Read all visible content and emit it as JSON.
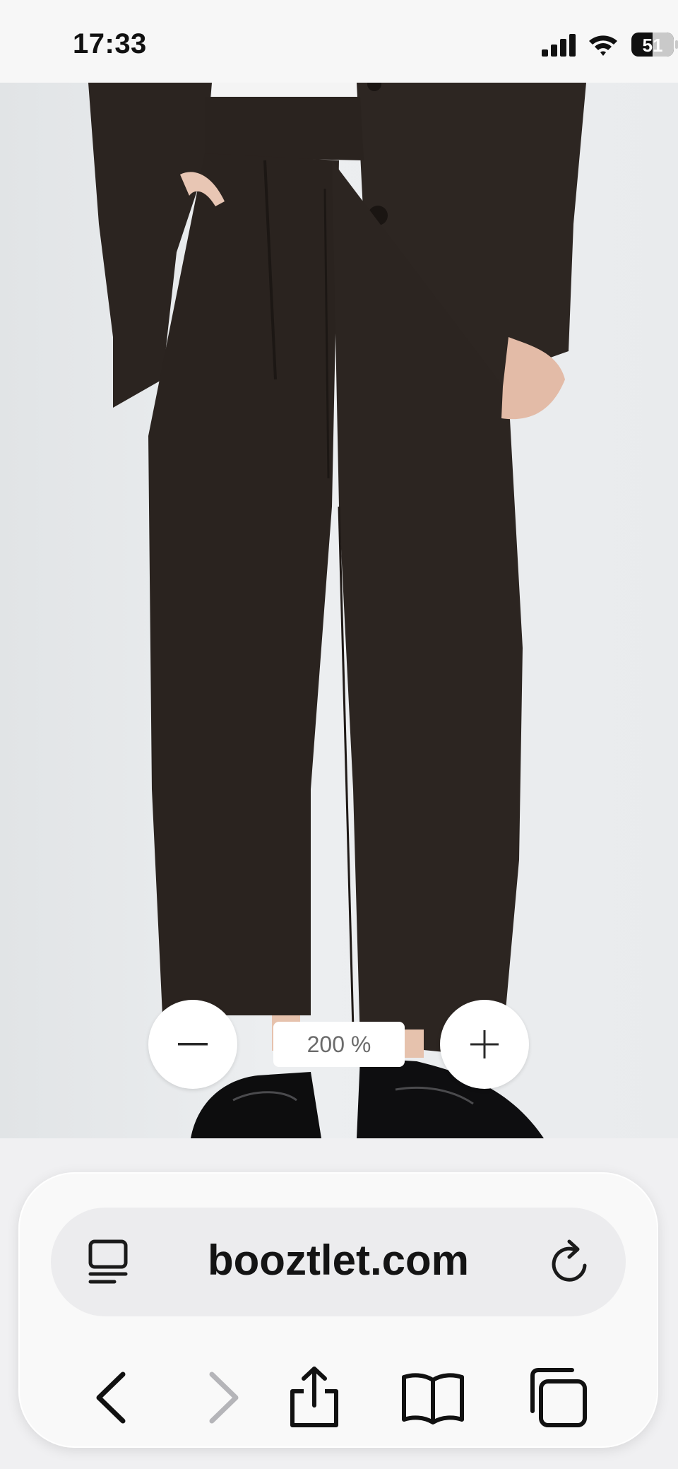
{
  "status_bar": {
    "time": "17:33",
    "battery_level": "51",
    "icons": [
      "signal-icon",
      "wifi-icon",
      "battery-icon"
    ]
  },
  "product_image": {
    "subject": "pleated-wide-trousers-photo"
  },
  "zoom": {
    "level_label": "200 %",
    "zoom_out_icon": "minus-icon",
    "zoom_in_icon": "plus-icon"
  },
  "browser": {
    "url": "booztlet.com",
    "reader_icon": "reader-icon",
    "reload_icon": "reload-icon",
    "nav_icons": [
      "back-icon",
      "forward-icon",
      "share-icon",
      "bookmarks-icon",
      "tabs-icon"
    ]
  },
  "colors": {
    "garment": "#2b2420",
    "background": "#e8eaec",
    "accent_disabled": "#b5b5b9"
  }
}
